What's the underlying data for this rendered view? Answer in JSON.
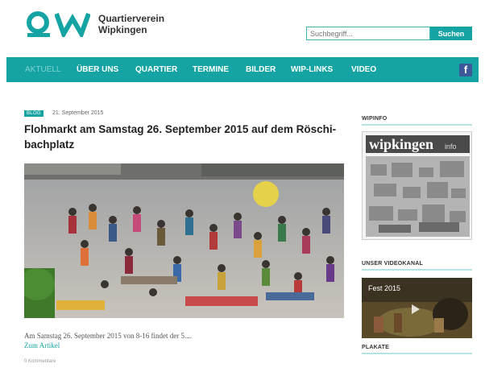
{
  "brand": {
    "line1": "Quartierverein",
    "line2": "Wipkingen",
    "color": "#16a3a3"
  },
  "search": {
    "placeholder": "Suchbegriff...",
    "button_label": "Suchen"
  },
  "nav": {
    "items": [
      "AKTUELL",
      "ÜBER UNS",
      "QUARTIER",
      "TERMINE",
      "BILDER",
      "WIP-LINKS",
      "VIDEO"
    ],
    "active": "AKTUELL",
    "facebook_icon": "f"
  },
  "article": {
    "badge": "BLOG",
    "date": "21. September 2015",
    "title": "Flohmarkt am Samstag 26. September 2015 auf dem Röschi-bachplatz",
    "excerpt": "Am Samstag 26. September 2015 von 8-16 findet der 5....",
    "readmore": "Zum Artikel",
    "comments": "0 Kommentare"
  },
  "sidebar": {
    "wipinfo_heading": "WIPINFO",
    "wipinfo_cover_title": "wipkingen",
    "wipinfo_cover_suffix": "info",
    "video_heading": "UNSER VIDEOKANAL",
    "video_caption": "Fest 2015",
    "plakate_heading": "PLAKATE"
  }
}
